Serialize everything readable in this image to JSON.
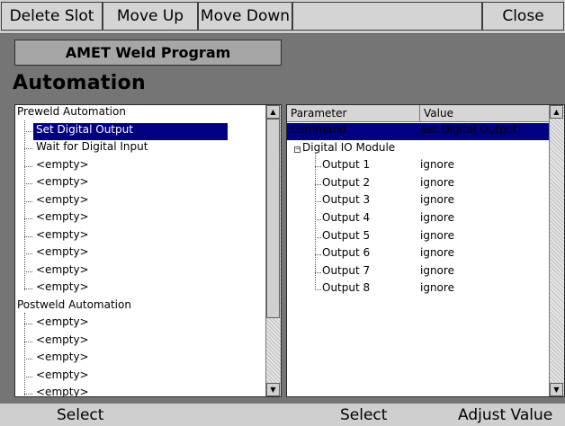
{
  "toolbar": {
    "delete_slot": "Delete Slot",
    "move_up": "Move Up",
    "move_down": "Move Down",
    "close": "Close"
  },
  "program_title": "AMET Weld Program",
  "section_title": "Automation",
  "tree": {
    "preweld_group": "Preweld Automation",
    "preweld_items": [
      "Set Digital Output",
      "Wait for Digital Input",
      "<empty>",
      "<empty>",
      "<empty>",
      "<empty>",
      "<empty>",
      "<empty>",
      "<empty>",
      "<empty>"
    ],
    "postweld_group": "Postweld Automation",
    "postweld_items": [
      "<empty>",
      "<empty>",
      "<empty>",
      "<empty>",
      "<empty>"
    ]
  },
  "params": {
    "header_parameter": "Parameter",
    "header_value": "Value",
    "command_label": "Command",
    "command_value": "Set Digital Output",
    "module_label": "Digital IO Module",
    "outputs": [
      {
        "label": "Output 1",
        "value": "ignore"
      },
      {
        "label": "Output 2",
        "value": "ignore"
      },
      {
        "label": "Output 3",
        "value": "ignore"
      },
      {
        "label": "Output 4",
        "value": "ignore"
      },
      {
        "label": "Output 5",
        "value": "ignore"
      },
      {
        "label": "Output 6",
        "value": "ignore"
      },
      {
        "label": "Output 7",
        "value": "ignore"
      },
      {
        "label": "Output 8",
        "value": "ignore"
      }
    ]
  },
  "bottom": {
    "select_left": "Select",
    "select_right": "Select",
    "adjust_value": "Adjust Value"
  },
  "colors": {
    "selection": "#000080",
    "background": "#757575"
  }
}
